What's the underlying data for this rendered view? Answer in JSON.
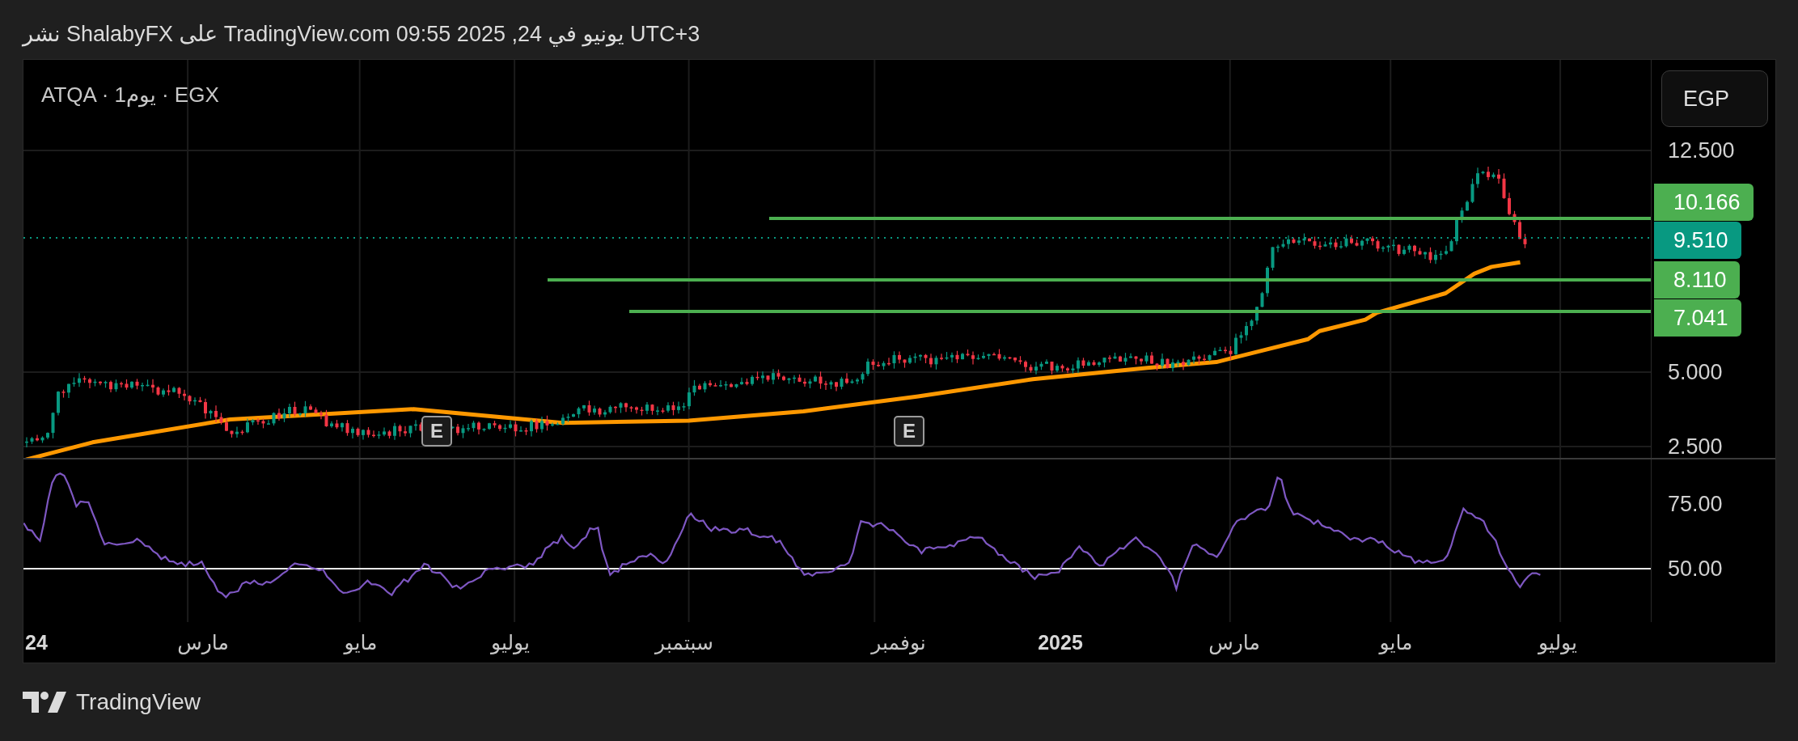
{
  "header": {
    "text": "UTC+3 يونيو في 24, 2025 09:55 TradingView.com على ShalabyFX نشر"
  },
  "chart": {
    "legend": "ATQA · 1يوم · EGX",
    "currency_button": "EGP",
    "price_scale": [
      "12.500",
      "5.000",
      "2.500"
    ],
    "price_labels": [
      {
        "text": "10.166",
        "kind": "level"
      },
      {
        "text": "9.510",
        "kind": "last_price"
      },
      {
        "text": "8.110",
        "kind": "level"
      },
      {
        "text": "7.041",
        "kind": "level"
      }
    ],
    "event_markers": [
      "E",
      "E"
    ],
    "rsi_scale": [
      "75.00",
      "50.00"
    ],
    "time_axis": [
      {
        "text": "يوليو",
        "kind": "month"
      },
      {
        "text": "مايو",
        "kind": "month"
      },
      {
        "text": "مارس",
        "kind": "month"
      },
      {
        "text": "2025",
        "kind": "year"
      },
      {
        "text": "نوفمبر",
        "kind": "month"
      },
      {
        "text": "سبتمبر",
        "kind": "month"
      },
      {
        "text": "يوليو",
        "kind": "month"
      },
      {
        "text": "مايو",
        "kind": "month"
      },
      {
        "text": "مارس",
        "kind": "month"
      },
      {
        "text": "24",
        "kind": "year"
      }
    ]
  },
  "footer": {
    "brand": "TradingView"
  }
}
